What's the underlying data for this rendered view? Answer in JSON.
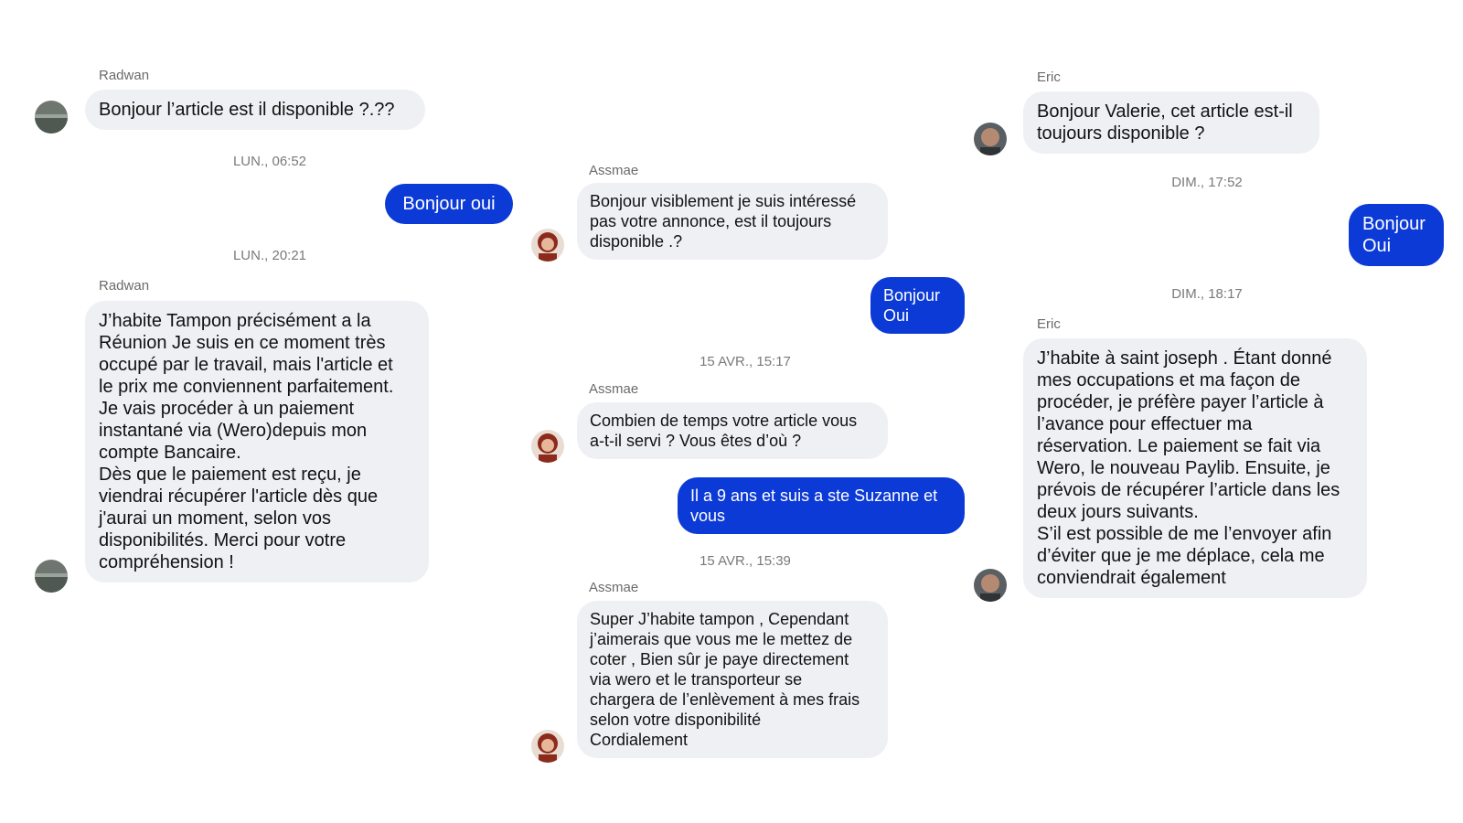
{
  "conversations": [
    {
      "contact": "Radwan",
      "messages": [
        {
          "from": "them",
          "sender": "Radwan",
          "text": "Bonjour l’article est il disponible ?.??"
        },
        {
          "timestamp": "LUN., 06:52"
        },
        {
          "from": "me",
          "text": "Bonjour oui"
        },
        {
          "timestamp": "LUN., 20:21"
        },
        {
          "from": "them",
          "sender": "Radwan",
          "text": "J’habite Tampon précisément a la\nRéunion  Je suis en ce moment très\noccupé par le travail, mais l'article et\nle prix me conviennent parfaitement.\nJe vais procéder à un paiement\ninstantané via (Wero)depuis mon\ncompte Bancaire.\nDès que le paiement est reçu, je\nviendrai récupérer l'article dès que\nj'aurai un moment, selon vos\ndisponibilités. Merci pour votre\ncompréhension !"
        }
      ]
    },
    {
      "contact": "Assmae",
      "messages": [
        {
          "from": "them",
          "sender": "Assmae",
          "text": "Bonjour visiblement je suis intéressé\npas votre annonce, est il toujours\ndisponible .?"
        },
        {
          "from": "me",
          "text": "Bonjour\nOui"
        },
        {
          "timestamp": "15 AVR., 15:17"
        },
        {
          "from": "them",
          "sender": "Assmae",
          "text": "Combien de temps votre article vous\na-t-il servi ? Vous êtes d’où ?"
        },
        {
          "from": "me",
          "text": "Il a 9 ans et suis a ste Suzanne et\nvous"
        },
        {
          "timestamp": "15 AVR., 15:39"
        },
        {
          "from": "them",
          "sender": "Assmae",
          "text": "Super J’habite tampon  , Cependant\nj’aimerais que vous me le mettez de\ncoter , Bien sûr je paye directement\nvia wero et le transporteur se\nchargera de l’enlèvement à mes frais\nselon votre disponibilité\nCordialement"
        }
      ]
    },
    {
      "contact": "Eric",
      "messages": [
        {
          "from": "them",
          "sender": "Eric",
          "text": "Bonjour Valerie, cet article est-il\ntoujours disponible ?"
        },
        {
          "timestamp": "DIM., 17:52"
        },
        {
          "from": "me",
          "text": "Bonjour\nOui"
        },
        {
          "timestamp": "DIM., 18:17"
        },
        {
          "from": "them",
          "sender": "Eric",
          "text": "J’habite à saint joseph . Étant donné\nmes occupations et ma façon de\nprocéder, je préfère payer l’article à\nl’avance pour effectuer ma\nréservation. Le paiement se fait via\nWero, le nouveau Paylib. Ensuite, je\nprévois de récupérer l’article dans les\ndeux jours suivants.\nS’il est possible de me l’envoyer afin\nd’éviter que je me déplace, cela me\nconviendrait également"
        }
      ]
    }
  ],
  "colors": {
    "incoming_bubble": "#eef0f4",
    "outgoing_bubble": "#0c3ad6",
    "outgoing_text": "#ffffff",
    "timestamp_text": "#7a7a7a",
    "sender_text": "#6b6b6b"
  }
}
